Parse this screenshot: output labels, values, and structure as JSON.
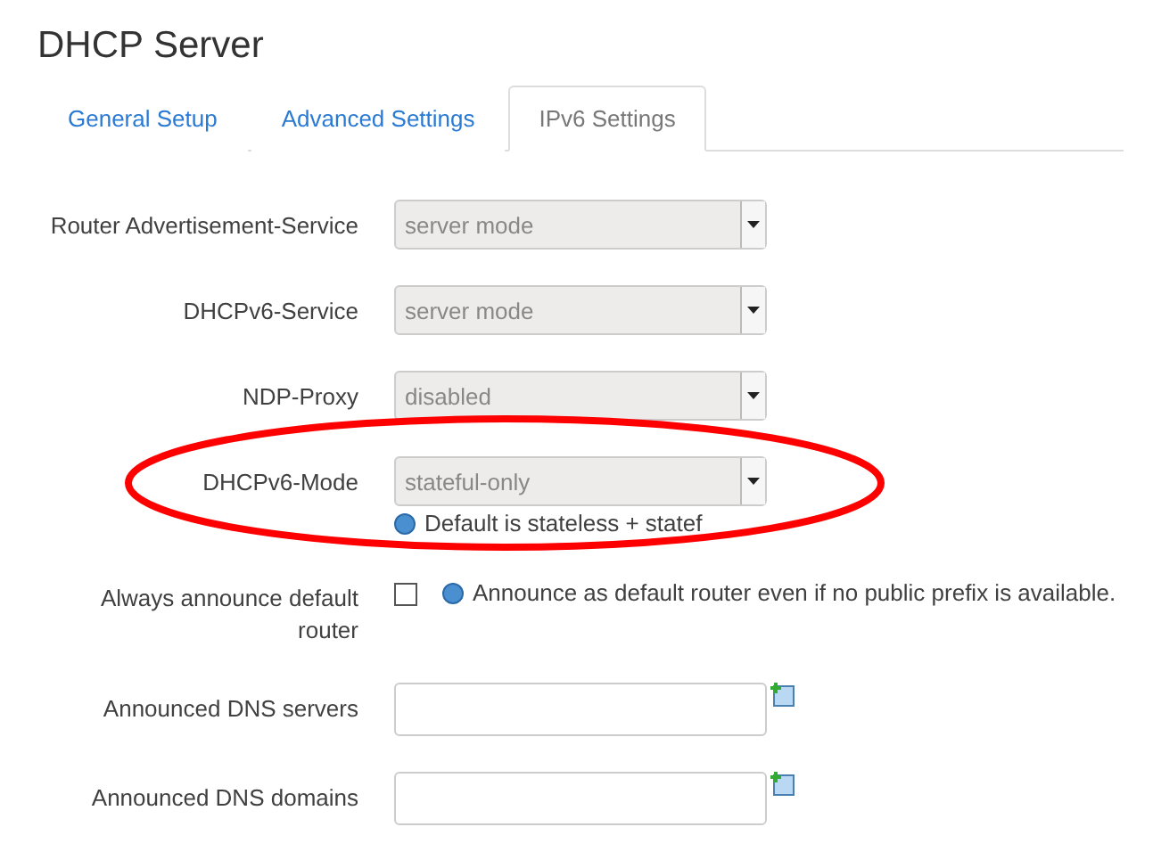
{
  "title": "DHCP Server",
  "tabs": [
    {
      "label": "General Setup",
      "selected": false
    },
    {
      "label": "Advanced Settings",
      "selected": false
    },
    {
      "label": "IPv6 Settings",
      "selected": true
    }
  ],
  "fields": [
    {
      "kind": "select",
      "label": "Router Advertisement-Service",
      "value": "server mode"
    },
    {
      "kind": "select",
      "label": "DHCPv6-Service",
      "value": "server mode"
    },
    {
      "kind": "select",
      "label": "NDP-Proxy",
      "value": "disabled"
    },
    {
      "kind": "select",
      "label": "DHCPv6-Mode",
      "value": "stateful-only",
      "help": "Default is stateless + statef",
      "highlighted": true
    },
    {
      "kind": "checkbox",
      "label": "Always announce default router",
      "checked": false,
      "help": "Announce as default router even if no public prefix is available."
    },
    {
      "kind": "list",
      "label": "Announced DNS servers"
    },
    {
      "kind": "list",
      "label": "Announced DNS domains"
    }
  ]
}
